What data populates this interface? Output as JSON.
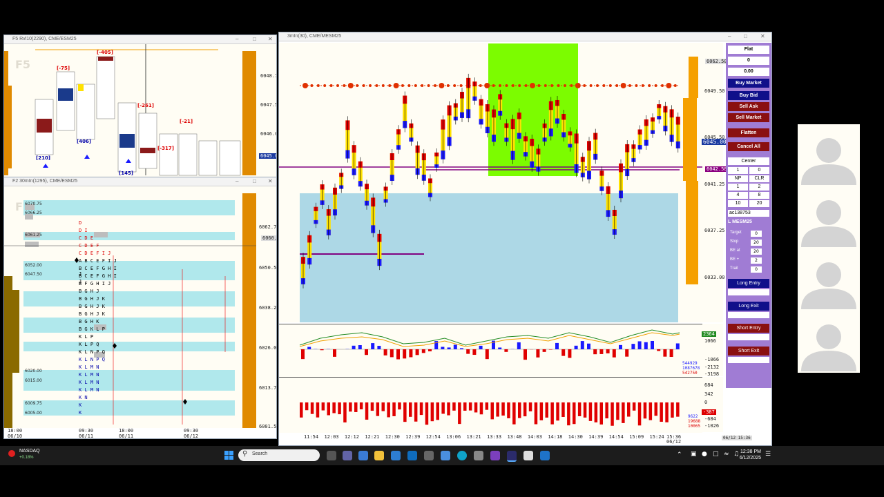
{
  "left_top_window": {
    "title": "F5 Rvl10(2290), CME/ESM25",
    "watermark": "F5",
    "y_axis": [
      "6048.75",
      "6047.50",
      "6046.00",
      "6045.00"
    ],
    "price_badge": "6045.00",
    "annotations": [
      "[-405]",
      "[-75]",
      "[406]",
      "[-261]",
      "[-21]",
      "[-317]",
      "[210]",
      "[145]"
    ]
  },
  "left_bottom_window": {
    "title": "F2 30mIn(1295), CME/ESM25",
    "watermark": "F2",
    "y_axis": [
      "6062.75",
      "6060.25",
      "6050.50",
      "6038.25",
      "6026.00",
      "6013.75",
      "6001.50"
    ],
    "price_levels": [
      "6070.75",
      "6066.25",
      "6061.25",
      "6052.00",
      "6047.50",
      "6020.00",
      "6015.00",
      "6009.75",
      "6005.00"
    ],
    "x_axis": [
      {
        "time": "18:00",
        "date": "06/10"
      },
      {
        "time": "09:30",
        "date": "06/11"
      },
      {
        "time": "18:00",
        "date": "06/11"
      },
      {
        "time": "09:30",
        "date": "06/12"
      }
    ],
    "tpo_letters": [
      "D",
      "D I",
      "C D E",
      "C D E F",
      "C D E F I J",
      "A B C E F I J",
      "B C E F G H I J",
      "B C E F G H I J",
      "B F G H I J",
      "B G H J",
      "B G H J K",
      "B G H J K",
      "B G H J K",
      "B G H K",
      "B G K L P",
      "K L P",
      "K L P Q",
      "K L N P Q",
      "K L N P Q",
      "K L M N",
      "K L M N",
      "K L M N",
      "K L M N",
      "K N",
      "K",
      "K"
    ]
  },
  "main_window": {
    "title": "3mIn(30), CME/MESM25",
    "y_axis": [
      "6049.50",
      "6045.50",
      "6041.25",
      "6037.25",
      "6033.00"
    ],
    "price_badges": {
      "top": "6062.50",
      "current": "6045.00",
      "purple": "6042.50",
      "ind": "6037.25"
    },
    "x_axis": [
      "11:54",
      "12:03",
      "12:12",
      "12:21",
      "12:30",
      "12:39",
      "12:54",
      "13:06",
      "13:21",
      "13:33",
      "13:48",
      "14:03",
      "14:18",
      "14:30",
      "14:39",
      "14:54",
      "15:09",
      "15:24",
      "15:36"
    ],
    "x_axis_date": "06/12",
    "timestamp": "06/12 15:36",
    "indicator1_axis": [
      "2364",
      "1066",
      "-1066",
      "-2132",
      "-3198"
    ],
    "indicator1_labels": [
      "544929",
      "1087678",
      "542750"
    ],
    "indicator2_axis": [
      "684",
      "342",
      "0",
      "-684",
      "-1026"
    ],
    "indicator2_labels": [
      "9622",
      "19688",
      "10065"
    ],
    "indicator2_badge": "-387"
  },
  "dom_panel": {
    "position": "Flat",
    "qty": "0",
    "pnl": "0.00",
    "buttons": {
      "buy_market": "Buy Market",
      "buy_bid": "Buy Bid",
      "sell_ask": "Sell Ask",
      "sell_market": "Sell Market",
      "flatten": "Flatten",
      "cancel_all": "Cancel All",
      "center": "Center",
      "long_entry": "Long Entry",
      "long_exit": "Long Exit",
      "short_entry": "Short Entry",
      "short_exit": "Short Exit"
    },
    "qty_grid": [
      "1",
      "0",
      "NP",
      "CLR",
      "1",
      "2",
      "4",
      "8",
      "10",
      "20"
    ],
    "account": "ac138753",
    "symbol": "L MESM25",
    "settings": [
      {
        "label": "Target",
        "value": "0"
      },
      {
        "label": "Stop",
        "value": "20"
      },
      {
        "label": "BE at",
        "value": "20"
      },
      {
        "label": "BE +",
        "value": "2"
      },
      {
        "label": "Trail",
        "value": "0"
      }
    ]
  },
  "taskbar": {
    "stock_name": "NASDAQ",
    "stock_change": "+0.18%",
    "search_placeholder": "Search",
    "time": "12:38 PM",
    "date": "6/12/2025"
  },
  "colors": {
    "green_zone": "#7cfc00",
    "blue_zone": "#add8e6",
    "up_bar": "#ffe100",
    "down_bar": "#e00000",
    "blue_bar": "#1a1aff",
    "dom_bg": "#a07cd4",
    "dom_button_blue": "#1010a0",
    "dom_button_red": "#a01010"
  }
}
